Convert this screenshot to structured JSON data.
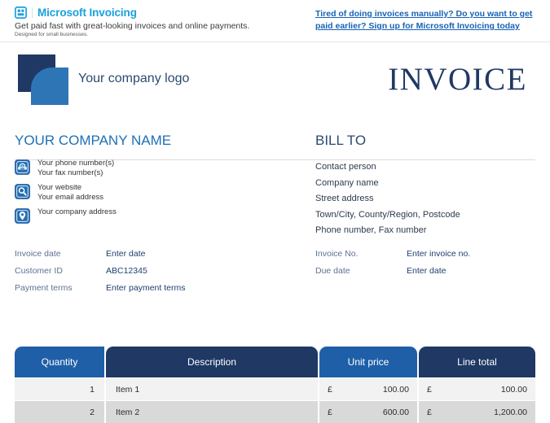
{
  "promo": {
    "icon": "microsoft-invoicing-icon",
    "brand": "Microsoft Invoicing",
    "tagline": "Get paid fast with great-looking invoices and online payments.",
    "subtagline": "Designed for small businesses.",
    "link": "Tired of doing invoices manually? Do you want to get paid earlier? Sign up for Microsoft Invoicing today",
    "link_color": "#1763b5",
    "brand_color": "#19a0dd"
  },
  "header": {
    "logo_placeholder": "Your company logo",
    "logo_back_color": "#1f3864",
    "logo_front_color": "#2e75b6",
    "title": "INVOICE",
    "title_color": "#1f3864"
  },
  "company": {
    "heading": "YOUR COMPANY NAME",
    "heading_color": "#1f6fb5",
    "contacts": [
      {
        "icon": "phone-icon",
        "line1": "Your phone number(s)",
        "line2": "Your fax number(s)"
      },
      {
        "icon": "search-icon",
        "line1": "Your website",
        "line2": "Your email address"
      },
      {
        "icon": "location-pin-icon",
        "line1": "Your company address",
        "line2": ""
      }
    ]
  },
  "bill_to": {
    "heading": "BILL TO",
    "lines": [
      "Contact person",
      "Company name",
      "Street address",
      "Town/City, County/Region, Postcode",
      "Phone number, Fax number"
    ]
  },
  "meta_left": [
    {
      "label": "Invoice date",
      "value": "Enter date"
    },
    {
      "label": "Customer ID",
      "value": "ABC12345"
    },
    {
      "label": "Payment terms",
      "value": "Enter payment terms"
    }
  ],
  "meta_right": [
    {
      "label": "Invoice No.",
      "value": "Enter invoice no."
    },
    {
      "label": "Due date",
      "value": "Enter date"
    }
  ],
  "table": {
    "columns": [
      "Quantity",
      "Description",
      "Unit price",
      "Line total"
    ],
    "header_colors": [
      "#1f5fa8",
      "#1f3864",
      "#1f5fa8",
      "#1f3864"
    ],
    "currency": "£",
    "rows": [
      {
        "quantity": "1",
        "description": "Item 1",
        "unit_currency": "£",
        "unit_price": "100.00",
        "total_currency": "£",
        "line_total": "100.00"
      },
      {
        "quantity": "2",
        "description": "Item 2",
        "unit_currency": "£",
        "unit_price": "600.00",
        "total_currency": "£",
        "line_total": "1,200.00"
      }
    ]
  }
}
